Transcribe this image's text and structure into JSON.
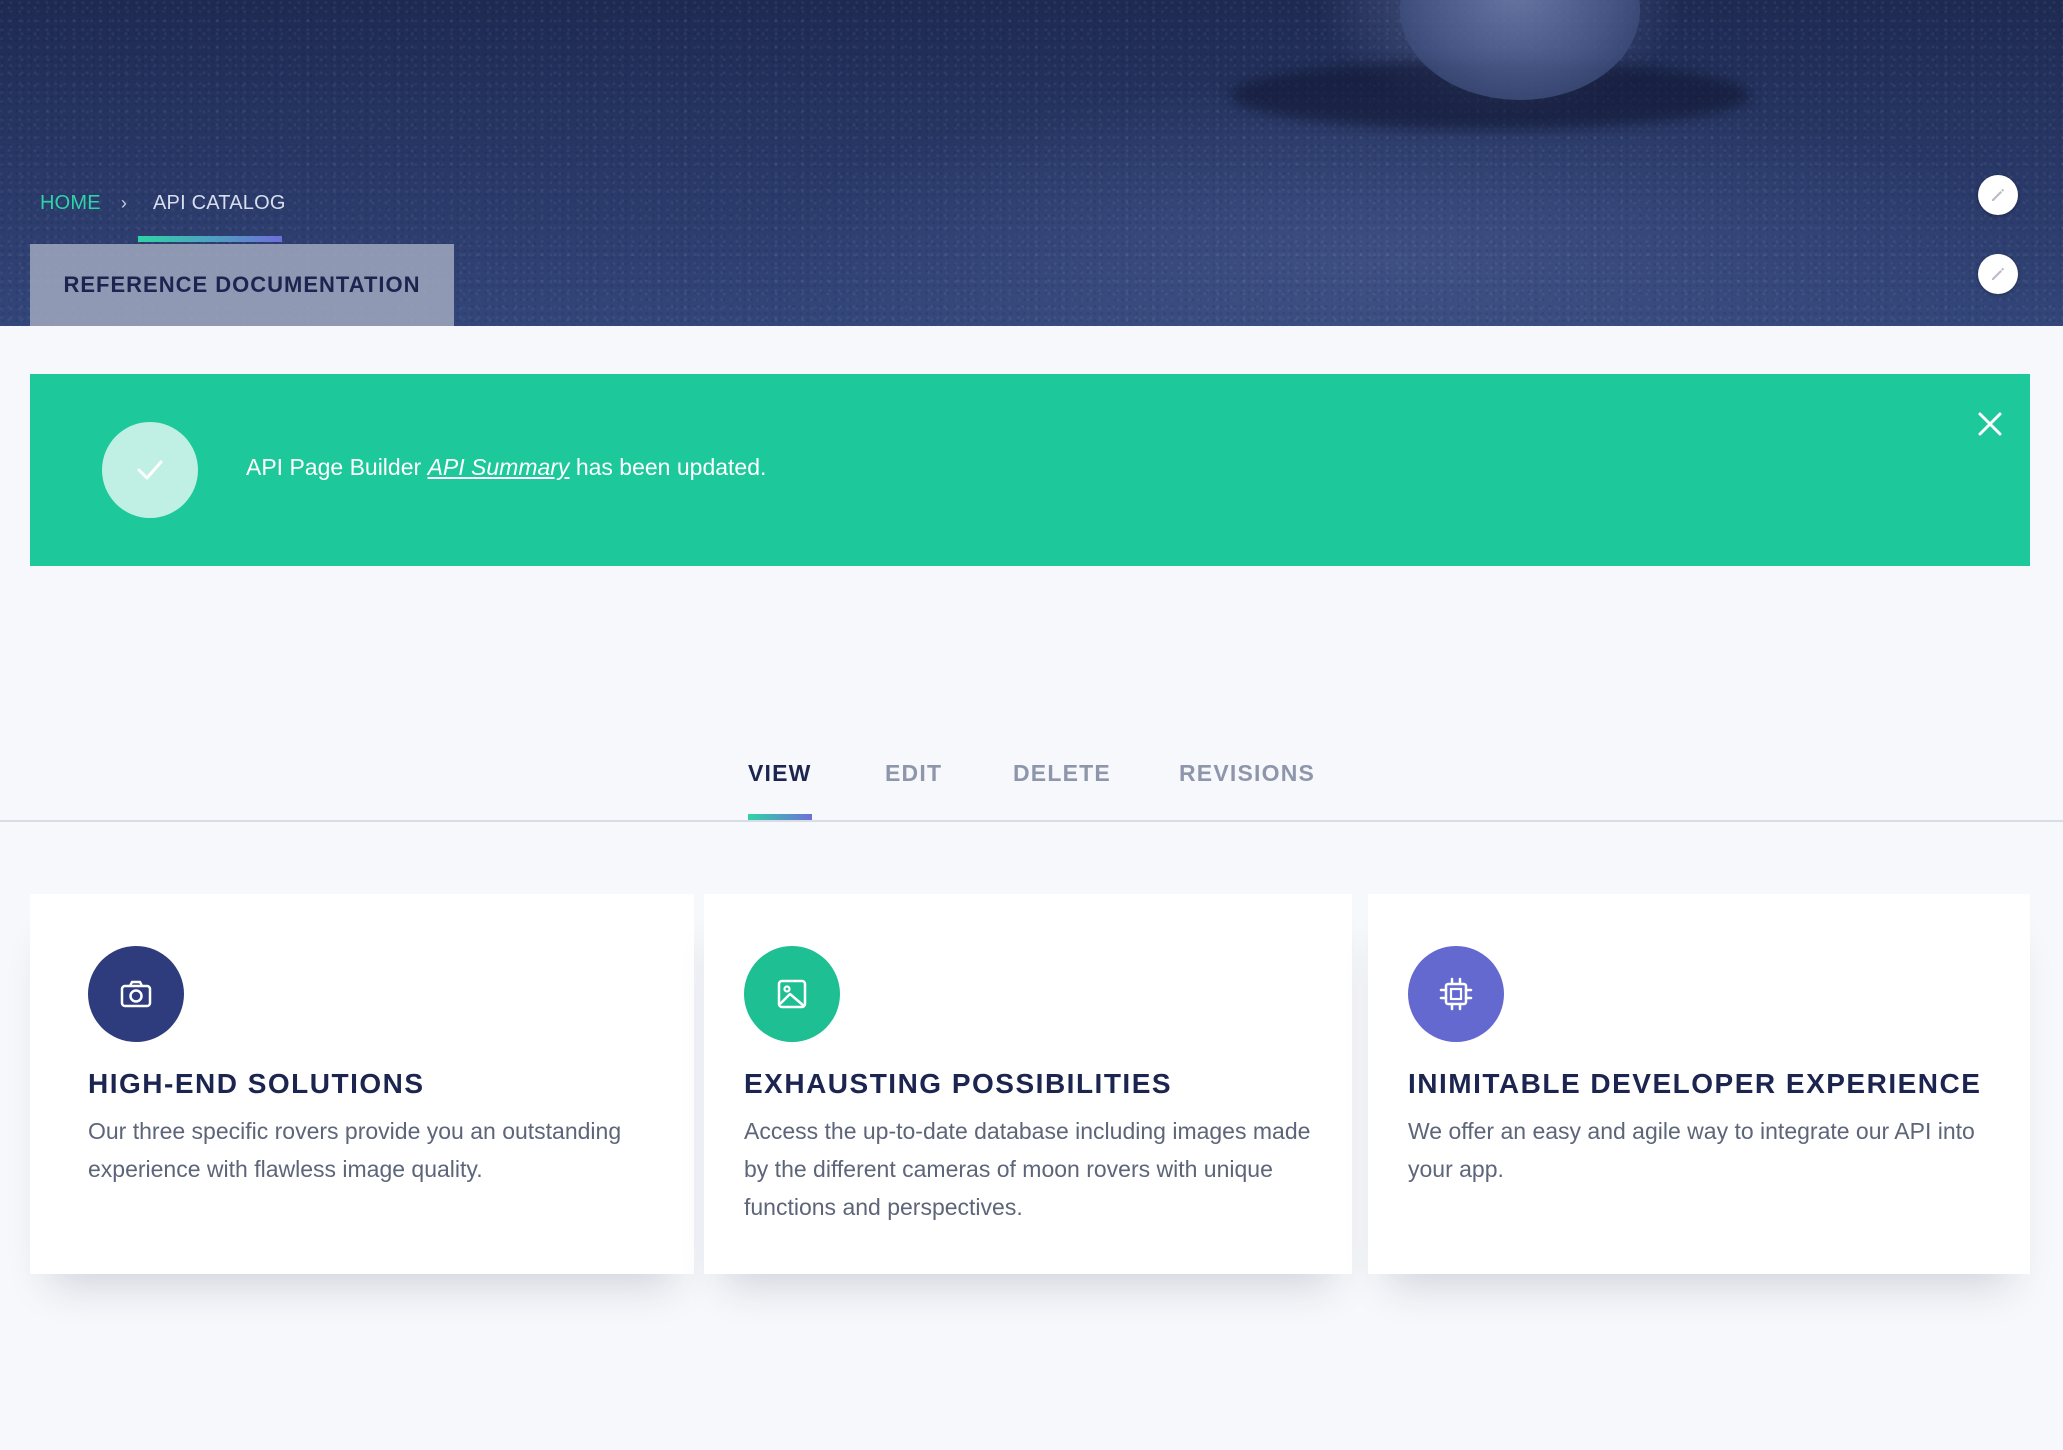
{
  "breadcrumb": {
    "home": "HOME",
    "separator": "›",
    "current": "API CATALOG"
  },
  "page_title": "REFERENCE DOCUMENTATION",
  "alert": {
    "prefix": "API Page Builder ",
    "link": "API Summary",
    "suffix": " has been updated."
  },
  "tabs": [
    {
      "label": "VIEW"
    },
    {
      "label": "EDIT"
    },
    {
      "label": "DELETE"
    },
    {
      "label": "REVISIONS"
    }
  ],
  "cards": [
    {
      "title": "HIGH-END SOLUTIONS",
      "description": "Our three specific rovers provide you an outstanding experience with flawless image quality.",
      "icon": "camera-icon",
      "color": "#2e3b7c"
    },
    {
      "title": "EXHAUSTING POSSIBILITIES",
      "description": "Access the up-to-date database including images made by the different cameras of moon rovers with unique functions and perspectives.",
      "icon": "image-icon",
      "color": "#1dbf93"
    },
    {
      "title": "INIMITABLE DEVELOPER EXPERIENCE",
      "description": "We offer an easy and agile way to integrate our API into your app.",
      "icon": "chip-icon",
      "color": "#6469d0"
    }
  ],
  "colors": {
    "accent_green": "#1dc89b",
    "navy": "#1c2550",
    "accent_purple": "#6e6fd8"
  }
}
